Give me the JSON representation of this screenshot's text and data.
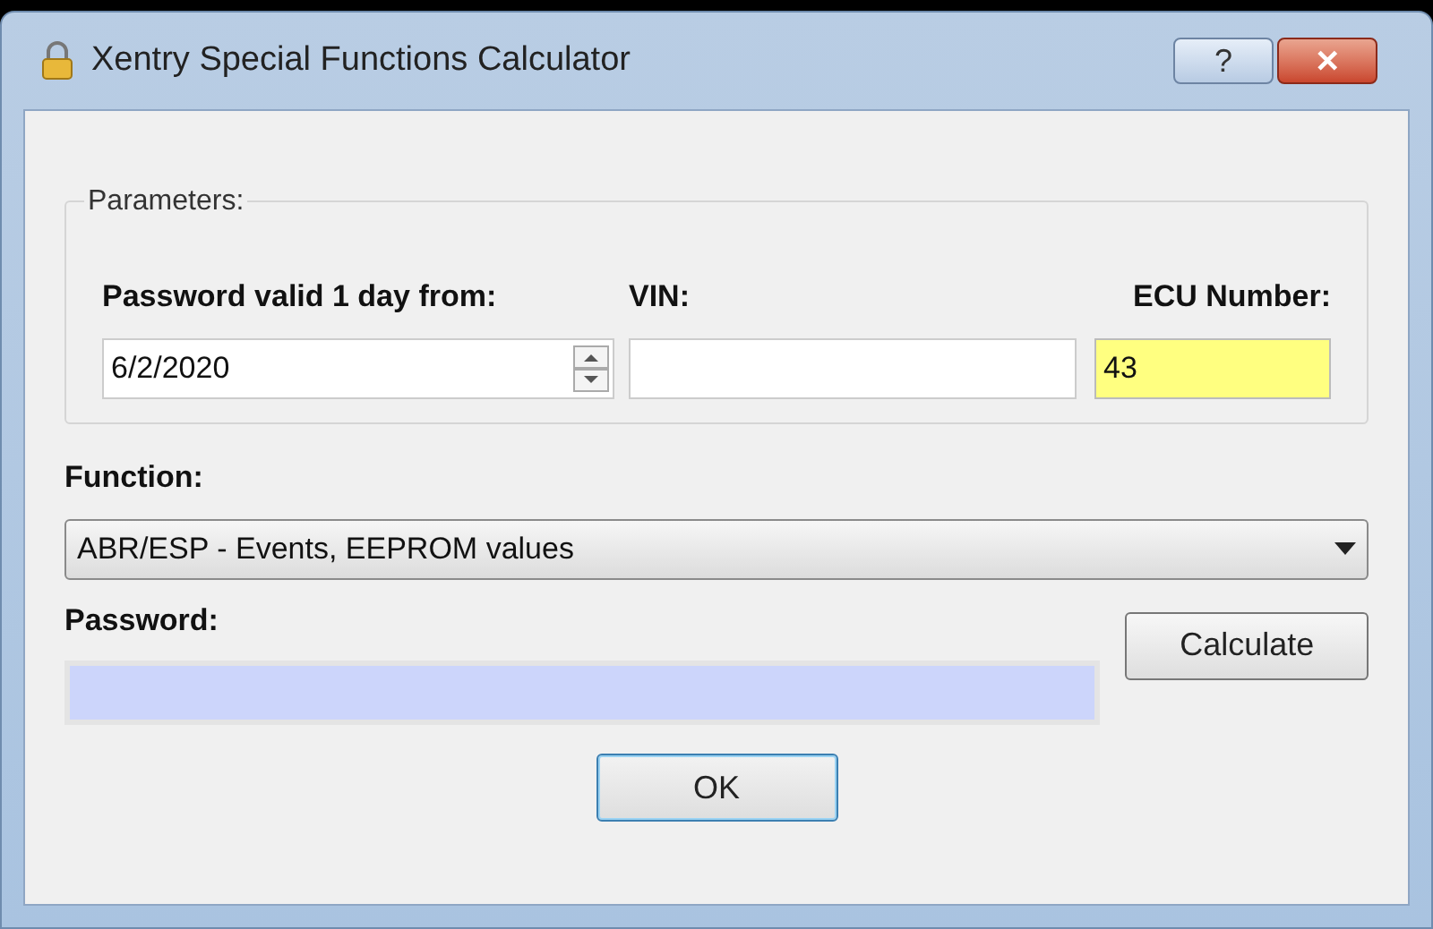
{
  "window": {
    "title": "Xentry Special Functions Calculator",
    "help": "?",
    "close": "✕"
  },
  "parameters": {
    "legend": "Parameters:",
    "date_label": "Password valid 1 day from:",
    "date_value": "6/2/2020",
    "vin_label": "VIN:",
    "ecu_label": "ECU Number:",
    "ecu_value": "43"
  },
  "function": {
    "label": "Function:",
    "value": "ABR/ESP - Events, EEPROM values"
  },
  "password": {
    "label": "Password:"
  },
  "buttons": {
    "calculate": "Calculate",
    "ok": "OK"
  }
}
